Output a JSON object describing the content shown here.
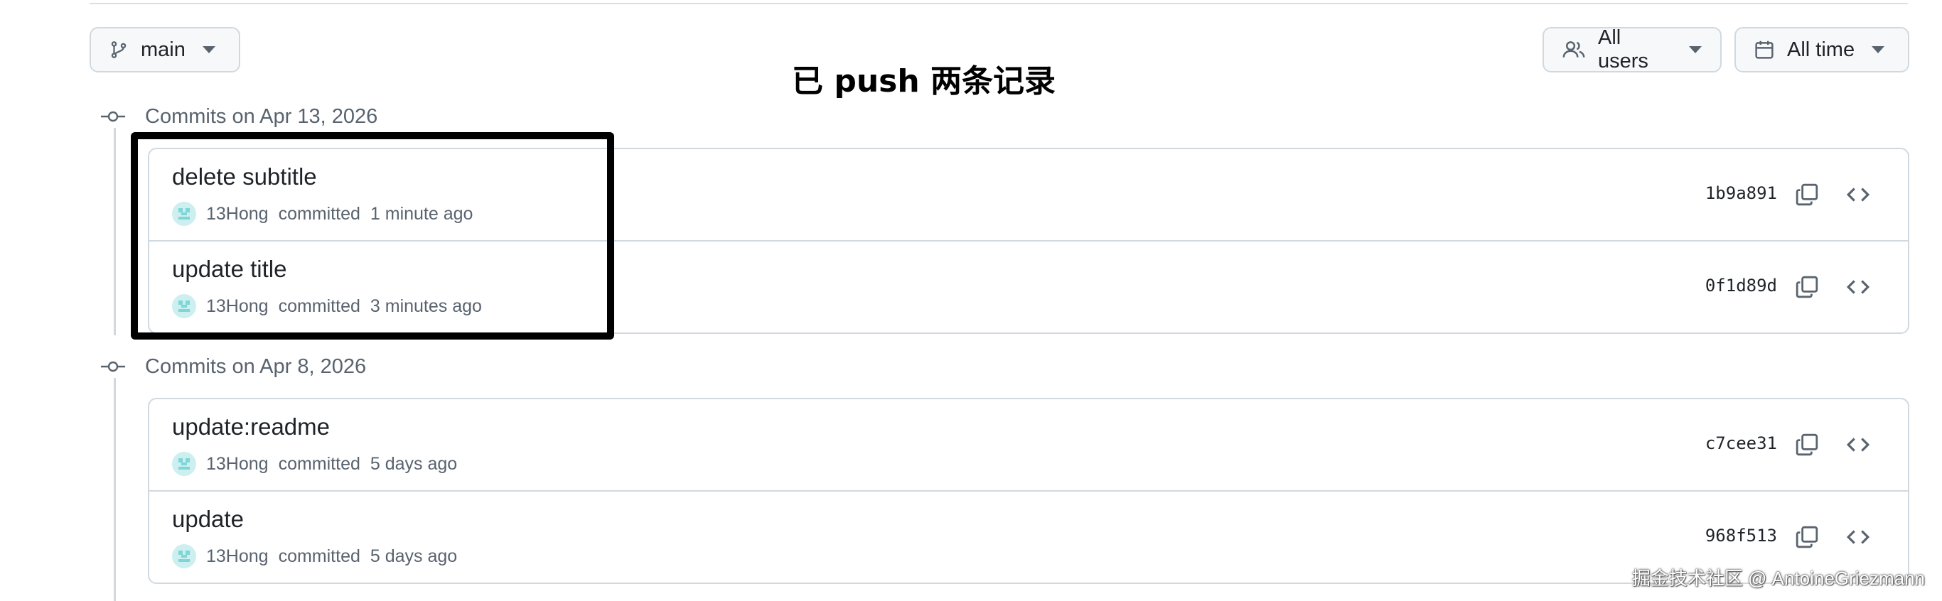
{
  "overlay_title": "已 push 两条记录",
  "toolbar": {
    "branch_label": "main",
    "branch_icon": "git-branch-icon",
    "users_label": "All users",
    "users_icon": "people-icon",
    "time_label": "All time",
    "time_icon": "calendar-icon"
  },
  "groups": [
    {
      "label": "Commits on Apr 13, 2026",
      "commits": [
        {
          "message": "delete subtitle",
          "author": "13Hong",
          "verb": "committed",
          "time": "1 minute ago",
          "sha": "1b9a891"
        },
        {
          "message": "update title",
          "author": "13Hong",
          "verb": "committed",
          "time": "3 minutes ago",
          "sha": "0f1d89d"
        }
      ]
    },
    {
      "label": "Commits on Apr 8, 2026",
      "commits": [
        {
          "message": "update:readme",
          "author": "13Hong",
          "verb": "committed",
          "time": "5 days ago",
          "sha": "c7cee31"
        },
        {
          "message": "update",
          "author": "13Hong",
          "verb": "committed",
          "time": "5 days ago",
          "sha": "968f513"
        }
      ]
    }
  ],
  "watermark": "掘金技术社区 @ AntoineGriezmann",
  "colors": {
    "border": "#d1d9e0",
    "muted_text": "#59636e",
    "highlight": "#000000"
  }
}
